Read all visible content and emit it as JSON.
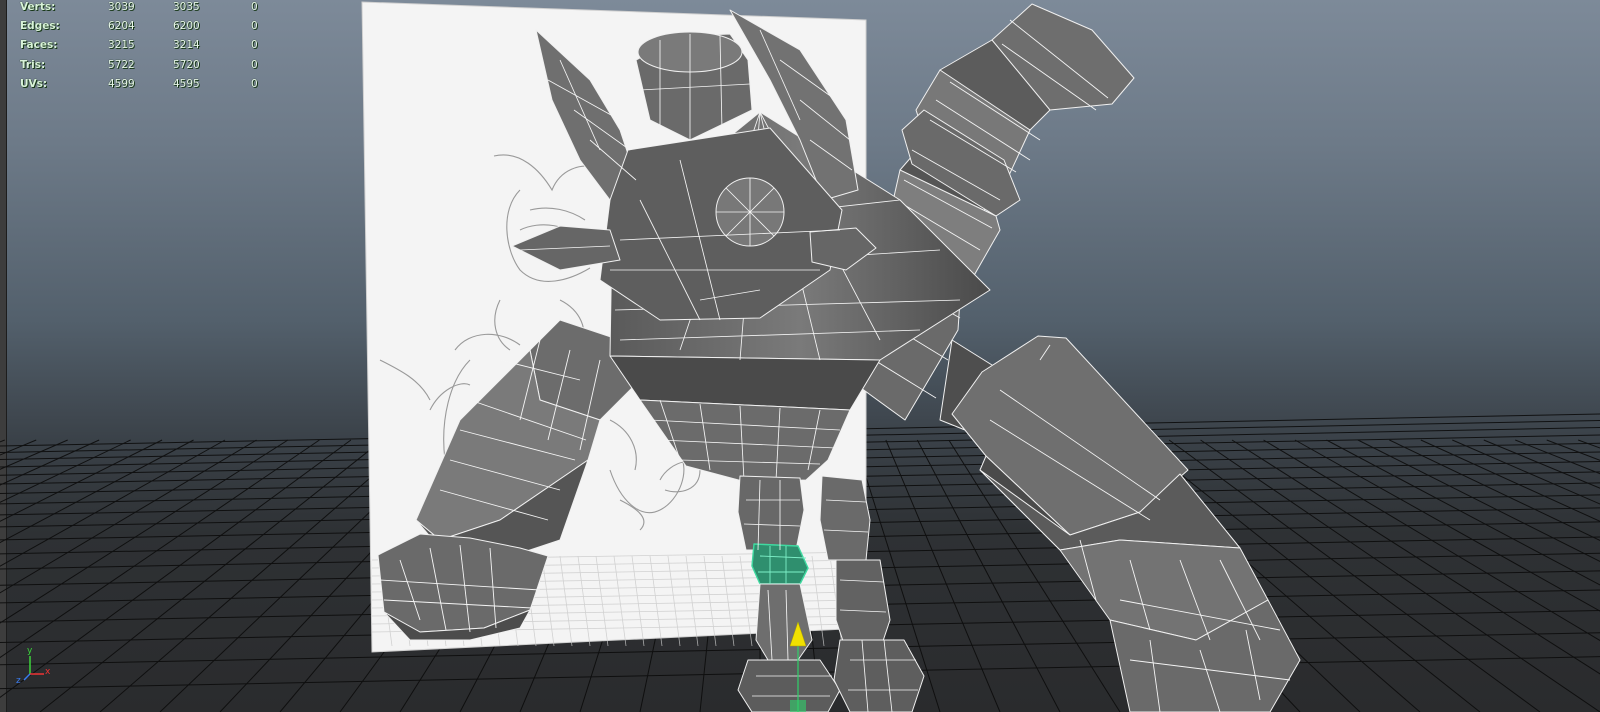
{
  "hud": {
    "rows": [
      {
        "label": "Verts:",
        "v1": "3039",
        "v2": "3035",
        "v3": "0"
      },
      {
        "label": "Edges:",
        "v1": "6204",
        "v2": "6200",
        "v3": "0"
      },
      {
        "label": "Faces:",
        "v1": "3215",
        "v2": "3214",
        "v3": "0"
      },
      {
        "label": "Tris:",
        "v1": "5722",
        "v2": "5720",
        "v3": "0"
      },
      {
        "label": "UVs:",
        "v1": "4599",
        "v2": "4595",
        "v3": "0"
      }
    ]
  },
  "axis": {
    "x_label": "x",
    "y_label": "y",
    "z_label": "z"
  },
  "colors": {
    "hud_text": "#d9f3d9",
    "mesh_fill": "#606060",
    "mesh_dark": "#3d3d3d",
    "mesh_light": "#8a8a8a",
    "wireframe": "#f2f2f2",
    "selection": "#3fd9a0",
    "pivot": "#f0e000",
    "grid": "#0d0d0d"
  },
  "icons": {
    "axis": "view-axis-triad-icon",
    "pivot": "pivot-manipulator-icon"
  }
}
